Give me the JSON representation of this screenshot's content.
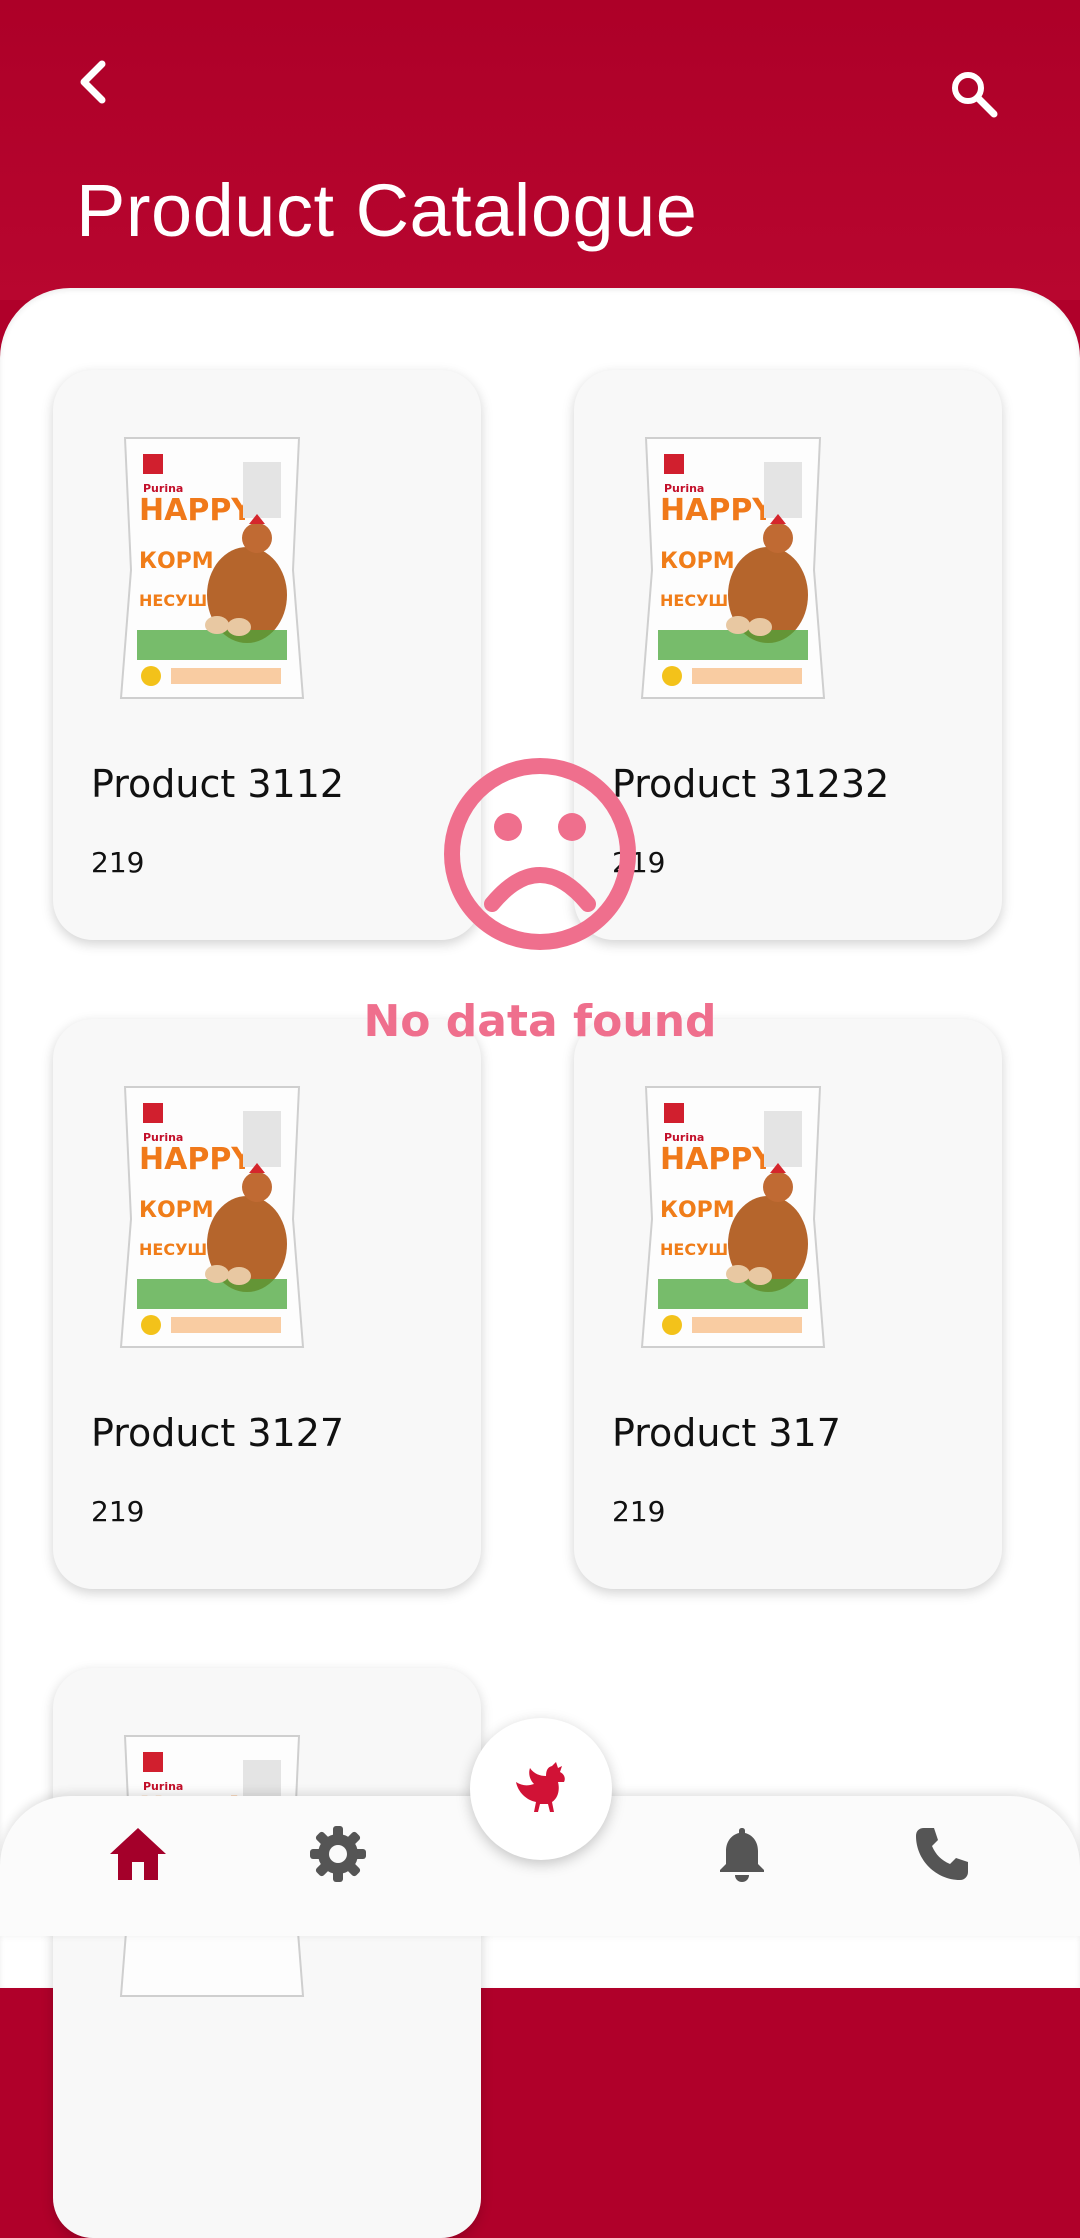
{
  "header": {
    "title": "Product Catalogue",
    "back_icon": "chevron-left-icon",
    "search_icon": "search-icon"
  },
  "products": [
    {
      "name": "Product 3112",
      "price": "219"
    },
    {
      "name": "Product 31232",
      "price": "219"
    },
    {
      "name": "Product 3127",
      "price": "219"
    },
    {
      "name": "Product 317",
      "price": "219"
    },
    {
      "name": "",
      "price": ""
    }
  ],
  "empty_state": {
    "message": "No data found",
    "icon": "sad-face-icon",
    "color": "#ef6f8d"
  },
  "bottom_nav": {
    "items": [
      "home-icon",
      "settings-gear-icon",
      "chicken-icon",
      "bell-icon",
      "phone-icon"
    ],
    "active": "home-icon"
  },
  "colors": {
    "brand": "#b0002a",
    "active_nav": "#a4002a",
    "inactive_nav": "#555555"
  }
}
